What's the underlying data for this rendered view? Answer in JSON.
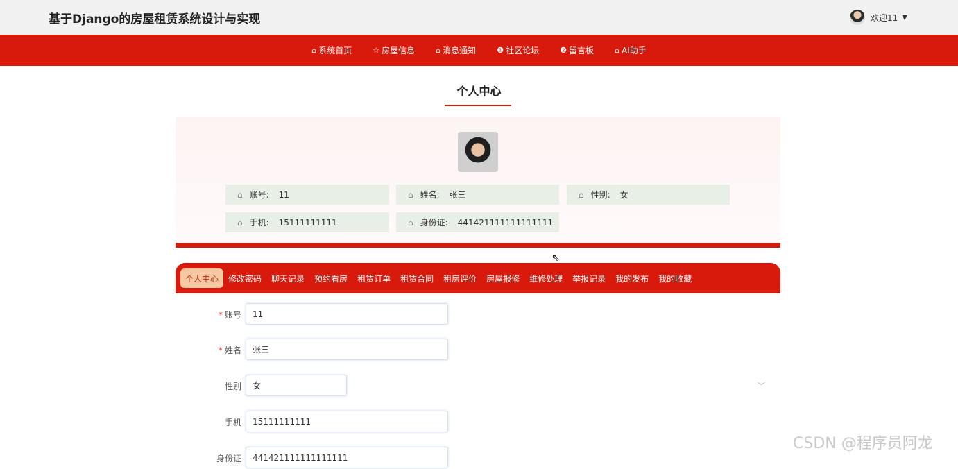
{
  "header": {
    "site_title": "基于Django的房屋租赁系统设计与实现",
    "welcome": "欢迎11"
  },
  "nav": [
    {
      "label": "系统首页",
      "icon": "home-icon",
      "glyph": "⌂"
    },
    {
      "label": "房屋信息",
      "icon": "star-icon",
      "glyph": "☆"
    },
    {
      "label": "消息通知",
      "icon": "bag-icon",
      "glyph": "⌂"
    },
    {
      "label": "社区论坛",
      "icon": "info-icon",
      "glyph": "❶"
    },
    {
      "label": "留言板",
      "icon": "question-icon",
      "glyph": "❷"
    },
    {
      "label": "AI助手",
      "icon": "home-icon",
      "glyph": "⌂"
    }
  ],
  "page": {
    "title": "个人中心"
  },
  "profile": {
    "account_label": "账号:",
    "account": "11",
    "name_label": "姓名:",
    "name": "张三",
    "gender_label": "性别:",
    "gender": "女",
    "phone_label": "手机:",
    "phone": "15111111111",
    "idcard_label": "身份证:",
    "idcard": "441421111111111111"
  },
  "tabs": [
    "个人中心",
    "修改密码",
    "聊天记录",
    "预约看房",
    "租赁订单",
    "租赁合同",
    "租房评价",
    "房屋报修",
    "维修处理",
    "举报记录",
    "我的发布",
    "我的收藏"
  ],
  "form": {
    "account_label": "账号",
    "account_value": "11",
    "name_label": "姓名",
    "name_value": "张三",
    "gender_label": "性别",
    "gender_value": "女",
    "phone_label": "手机",
    "phone_value": "15111111111",
    "idcard_label": "身份证",
    "idcard_value": "441421111111111111"
  },
  "watermark": "CSDN @程序员阿龙",
  "colors": {
    "primary_red": "#d71a0c",
    "chip_bg": "#e7efe6",
    "active_tab_bg": "#f7c9a3"
  }
}
